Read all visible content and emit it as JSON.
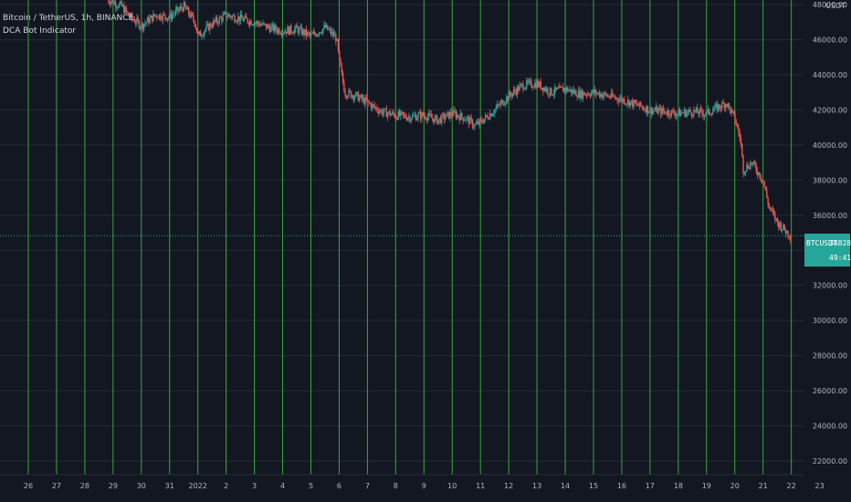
{
  "legend": {
    "title": "Bitcoin / TetherUS, 1h, BINANCE",
    "indicator": "DCA Bot Indicator"
  },
  "currency_label": "USDT",
  "price_tag": {
    "symbol": "BTCUSDT",
    "price": "34828.59",
    "countdown": "49:41"
  },
  "colors": {
    "background": "#131722",
    "up": "#26a69a",
    "down": "#ef5350",
    "vline": "#3fbf3f",
    "grid": "#232837",
    "axis_text": "#b2b5be"
  },
  "chart_data": {
    "type": "candlestick",
    "title": "Bitcoin / TetherUS, 1h, BINANCE",
    "indicator": "DCA Bot Indicator",
    "y_axis": {
      "ticks": [
        "22000.00",
        "24000.00",
        "26000.00",
        "28000.00",
        "30000.00",
        "32000.00",
        "34000.00",
        "36000.00",
        "38000.00",
        "40000.00",
        "42000.00",
        "44000.00",
        "46000.00",
        "48000.00"
      ],
      "ylim": [
        21200,
        48600
      ]
    },
    "x_axis": {
      "ticks": [
        "26",
        "27",
        "28",
        "29",
        "30",
        "31",
        "2022",
        "2",
        "3",
        "4",
        "5",
        "6",
        "7",
        "8",
        "9",
        "10",
        "11",
        "12",
        "13",
        "14",
        "15",
        "16",
        "17",
        "18",
        "19",
        "20",
        "21",
        "22",
        "23"
      ]
    },
    "vertical_markers": [
      "26",
      "27",
      "28",
      "29",
      "30",
      "31",
      "2022",
      "2",
      "3",
      "4",
      "5",
      "6",
      "7",
      "8",
      "9",
      "10",
      "11",
      "12",
      "13",
      "14",
      "15",
      "16",
      "17",
      "18",
      "19",
      "20",
      "21",
      "22"
    ],
    "last_price": 34828.59,
    "price_path": [
      {
        "d": 28.8,
        "p": 48300
      },
      {
        "d": 29.3,
        "p": 47900
      },
      {
        "d": 29.6,
        "p": 47300
      },
      {
        "d": 30.0,
        "p": 46800
      },
      {
        "d": 30.5,
        "p": 47400
      },
      {
        "d": 31.0,
        "p": 47300
      },
      {
        "d": 31.5,
        "p": 47900
      },
      {
        "d": 31.9,
        "p": 47000
      },
      {
        "d": 32.0,
        "p": 46200
      },
      {
        "d": 32.5,
        "p": 46900
      },
      {
        "d": 33.0,
        "p": 47400
      },
      {
        "d": 33.5,
        "p": 47200
      },
      {
        "d": 34.0,
        "p": 47000
      },
      {
        "d": 34.5,
        "p": 46700
      },
      {
        "d": 35.0,
        "p": 46500
      },
      {
        "d": 35.5,
        "p": 46600
      },
      {
        "d": 36.0,
        "p": 46200
      },
      {
        "d": 36.5,
        "p": 46700
      },
      {
        "d": 36.9,
        "p": 46100
      },
      {
        "d": 37.0,
        "p": 44800
      },
      {
        "d": 37.2,
        "p": 43000
      },
      {
        "d": 37.6,
        "p": 42800
      },
      {
        "d": 38.0,
        "p": 42400
      },
      {
        "d": 38.5,
        "p": 41900
      },
      {
        "d": 39.0,
        "p": 41700
      },
      {
        "d": 39.5,
        "p": 41600
      },
      {
        "d": 40.0,
        "p": 41700
      },
      {
        "d": 40.5,
        "p": 41400
      },
      {
        "d": 41.0,
        "p": 41800
      },
      {
        "d": 41.5,
        "p": 41500
      },
      {
        "d": 41.8,
        "p": 41100
      },
      {
        "d": 42.0,
        "p": 41300
      },
      {
        "d": 42.5,
        "p": 42000
      },
      {
        "d": 43.0,
        "p": 42800
      },
      {
        "d": 43.5,
        "p": 43400
      },
      {
        "d": 44.0,
        "p": 43500
      },
      {
        "d": 44.5,
        "p": 43000
      },
      {
        "d": 45.0,
        "p": 43200
      },
      {
        "d": 45.5,
        "p": 42900
      },
      {
        "d": 46.0,
        "p": 43000
      },
      {
        "d": 46.5,
        "p": 42800
      },
      {
        "d": 47.0,
        "p": 42600
      },
      {
        "d": 47.5,
        "p": 42300
      },
      {
        "d": 48.0,
        "p": 42000
      },
      {
        "d": 48.5,
        "p": 41900
      },
      {
        "d": 49.0,
        "p": 41800
      },
      {
        "d": 49.5,
        "p": 41900
      },
      {
        "d": 50.0,
        "p": 41800
      },
      {
        "d": 50.7,
        "p": 42400
      },
      {
        "d": 51.0,
        "p": 41500
      },
      {
        "d": 51.2,
        "p": 40300
      },
      {
        "d": 51.3,
        "p": 38600
      },
      {
        "d": 51.6,
        "p": 39000
      },
      {
        "d": 52.0,
        "p": 38000
      },
      {
        "d": 52.2,
        "p": 36500
      },
      {
        "d": 52.5,
        "p": 35600
      },
      {
        "d": 52.8,
        "p": 35100
      },
      {
        "d": 53.0,
        "p": 34830
      }
    ]
  }
}
